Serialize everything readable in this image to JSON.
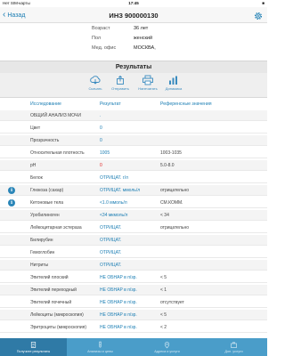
{
  "status_bar": {
    "carrier": "Нет SIM-карты",
    "time": "17:45",
    "battery": "■"
  },
  "nav": {
    "back_label": "Назад",
    "title": "ИНЗ 900000130"
  },
  "patient": [
    {
      "label": "Возраст",
      "value": "36 лет"
    },
    {
      "label": "Пол",
      "value": "женский"
    },
    {
      "label": "Мед. офис",
      "value": "МОСКВА,"
    }
  ],
  "results": {
    "title": "Результаты",
    "toolbar": [
      {
        "label": "Скачать",
        "icon": "cloud-download-icon"
      },
      {
        "label": "Отправить",
        "icon": "send-icon"
      },
      {
        "label": "Напечатать",
        "icon": "print-icon"
      },
      {
        "label": "Динамика",
        "icon": "bar-chart-icon"
      }
    ],
    "columns": [
      "Исследование",
      "Результат",
      "Референсные значения"
    ],
    "rows": [
      {
        "name": "ОБЩИЙ АНАЛИЗ МОЧИ",
        "result": ".",
        "ref": "",
        "info": false,
        "red": false
      },
      {
        "name": "Цвет",
        "result": "0",
        "ref": "",
        "info": false,
        "red": false
      },
      {
        "name": "Прозрачность",
        "result": "0",
        "ref": "",
        "info": false,
        "red": false
      },
      {
        "name": "Относительная плотность",
        "result": "1005",
        "ref": "1003-1035",
        "info": false,
        "red": false
      },
      {
        "name": "pH",
        "result": "0",
        "ref": "5.0-8.0",
        "info": false,
        "red": true
      },
      {
        "name": "Белок",
        "result": "ОТРИЦАТ. г/л",
        "ref": "",
        "info": false,
        "red": false
      },
      {
        "name": "Глюкоза (сахар)",
        "result": "ОТРИЦАТ. ммоль/л",
        "ref": "отрицательно",
        "info": true,
        "red": false
      },
      {
        "name": "Кетоновые тела",
        "result": "<1.0 ммоль/л",
        "ref": "СМ.КОММ.",
        "info": true,
        "red": false
      },
      {
        "name": "Уробилиноген",
        "result": "<34 мкмоль/л",
        "ref": "< 34",
        "info": false,
        "red": false
      },
      {
        "name": "Лейкоцитарная эстераза",
        "result": "ОТРИЦАТ.",
        "ref": "отрицательно",
        "info": false,
        "red": false
      },
      {
        "name": "Билирубин",
        "result": "ОТРИЦАТ.",
        "ref": "",
        "info": false,
        "red": false
      },
      {
        "name": "Гемоглобин",
        "result": "ОТРИЦАТ.",
        "ref": "",
        "info": false,
        "red": false
      },
      {
        "name": "Нитриты",
        "result": "ОТРИЦАТ.",
        "ref": "",
        "info": false,
        "red": false
      },
      {
        "name": "Эпителий плоский",
        "result": "НЕ ОБНАР в п/зр.",
        "ref": "< 5",
        "info": false,
        "red": false
      },
      {
        "name": "Эпителий переходный",
        "result": "НЕ ОБНАР в п/зр.",
        "ref": "< 1",
        "info": false,
        "red": false
      },
      {
        "name": "Эпителий почечный",
        "result": "НЕ ОБНАР в п/зр.",
        "ref": "отсутствует",
        "info": false,
        "red": false
      },
      {
        "name": "Лейкоциты (микроскопия)",
        "result": "НЕ ОБНАР в п/зр.",
        "ref": "< 5",
        "info": false,
        "red": false
      },
      {
        "name": "Эритроциты (микроскопия)",
        "result": "НЕ ОБНАР в п/зр.",
        "ref": "< 2",
        "info": false,
        "red": false
      }
    ]
  },
  "tabs": [
    {
      "label": "Получите результаты",
      "icon": "results-icon",
      "active": true
    },
    {
      "label": "Анализы и цены",
      "icon": "test-tube-icon",
      "active": false
    },
    {
      "label": "Адреса и услуги",
      "icon": "location-icon",
      "active": false
    },
    {
      "label": "Доп. услуги",
      "icon": "briefcase-icon",
      "active": false
    }
  ],
  "colors": {
    "accent": "#1a7db3",
    "tab_bar": "#4a9dc9",
    "tab_active": "#2f7aa6",
    "alert": "#e02020"
  }
}
